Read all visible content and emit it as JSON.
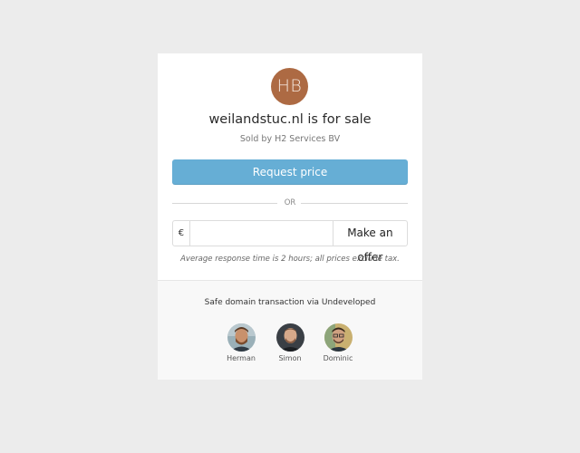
{
  "listing": {
    "initials": "HB",
    "domain_title": "weilandstuc.nl is for sale",
    "seller": "Sold by H2 Services BV",
    "request_price_label": "Request price",
    "or_label": "OR",
    "currency_symbol": "€",
    "offer_input_value": "",
    "make_offer_label": "Make an offer",
    "response_note": "Average response time is 2 hours; all prices exclude tax."
  },
  "footer": {
    "safe_transaction_text": "Safe domain transaction via Undeveloped",
    "team": [
      {
        "name": "Herman",
        "icon": "herman-avatar"
      },
      {
        "name": "Simon",
        "icon": "simon-avatar"
      },
      {
        "name": "Dominic",
        "icon": "dominic-avatar"
      }
    ]
  },
  "colors": {
    "background": "#ececec",
    "accent_button": "#66aed5",
    "initials_badge": "#ad6a43"
  }
}
